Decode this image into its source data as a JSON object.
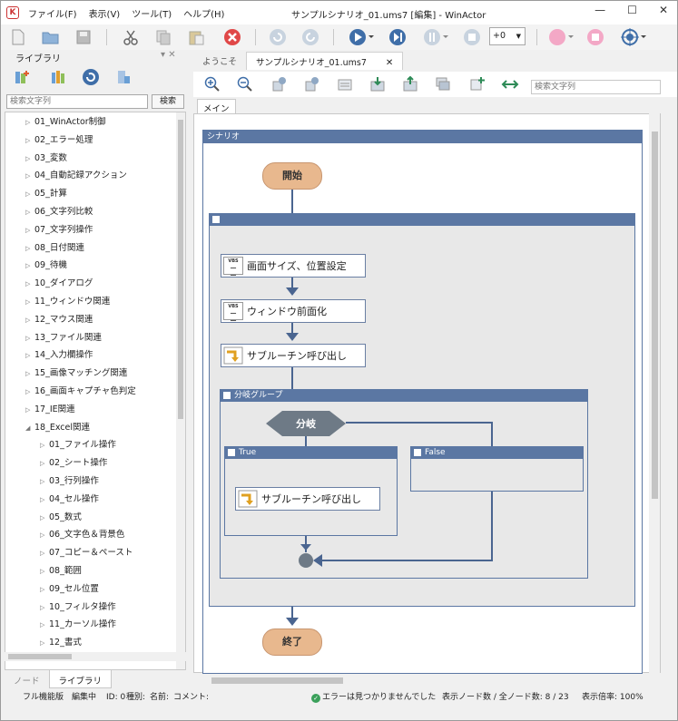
{
  "window": {
    "title": "サンプルシナリオ_01.ums7 [編集] - WinActor",
    "minimize": "—",
    "maximize": "☐",
    "close": "✕"
  },
  "menu": [
    "ファイル(F)",
    "表示(V)",
    "ツール(T)",
    "ヘルプ(H)"
  ],
  "toolbar": {
    "speed_value": "+0"
  },
  "library": {
    "title": "ライブラリ",
    "pin": "▾ ✕",
    "search_placeholder": "検索文字列",
    "search_button": "検索",
    "items": [
      {
        "label": "01_WinActor制御",
        "indent": 0,
        "expanded": false
      },
      {
        "label": "02_エラー処理",
        "indent": 0,
        "expanded": false
      },
      {
        "label": "03_変数",
        "indent": 0,
        "expanded": false
      },
      {
        "label": "04_自動記録アクション",
        "indent": 0,
        "expanded": false
      },
      {
        "label": "05_計算",
        "indent": 0,
        "expanded": false
      },
      {
        "label": "06_文字列比較",
        "indent": 0,
        "expanded": false
      },
      {
        "label": "07_文字列操作",
        "indent": 0,
        "expanded": false
      },
      {
        "label": "08_日付関連",
        "indent": 0,
        "expanded": false
      },
      {
        "label": "09_待機",
        "indent": 0,
        "expanded": false
      },
      {
        "label": "10_ダイアログ",
        "indent": 0,
        "expanded": false
      },
      {
        "label": "11_ウィンドウ関連",
        "indent": 0,
        "expanded": false
      },
      {
        "label": "12_マウス関連",
        "indent": 0,
        "expanded": false
      },
      {
        "label": "13_ファイル関連",
        "indent": 0,
        "expanded": false
      },
      {
        "label": "14_入力欄操作",
        "indent": 0,
        "expanded": false
      },
      {
        "label": "15_画像マッチング関連",
        "indent": 0,
        "expanded": false
      },
      {
        "label": "16_画面キャプチャ色判定",
        "indent": 0,
        "expanded": false
      },
      {
        "label": "17_IE関連",
        "indent": 0,
        "expanded": false
      },
      {
        "label": "18_Excel関連",
        "indent": 0,
        "expanded": true
      },
      {
        "label": "01_ファイル操作",
        "indent": 1,
        "expanded": false
      },
      {
        "label": "02_シート操作",
        "indent": 1,
        "expanded": false
      },
      {
        "label": "03_行列操作",
        "indent": 1,
        "expanded": false
      },
      {
        "label": "04_セル操作",
        "indent": 1,
        "expanded": false
      },
      {
        "label": "05_数式",
        "indent": 1,
        "expanded": false
      },
      {
        "label": "06_文字色＆背景色",
        "indent": 1,
        "expanded": false
      },
      {
        "label": "07_コピー＆ペースト",
        "indent": 1,
        "expanded": false
      },
      {
        "label": "08_範囲",
        "indent": 1,
        "expanded": false
      },
      {
        "label": "09_セル位置",
        "indent": 1,
        "expanded": false
      },
      {
        "label": "10_フィルタ操作",
        "indent": 1,
        "expanded": false
      },
      {
        "label": "11_カーソル操作",
        "indent": 1,
        "expanded": false
      },
      {
        "label": "12_書式",
        "indent": 1,
        "expanded": false
      }
    ],
    "bottom_tabs": [
      "ノード",
      "ライブラリ"
    ]
  },
  "editor": {
    "tabs": [
      {
        "label": "ようこそ",
        "active": false
      },
      {
        "label": "サンプルシナリオ_01.ums7",
        "active": true
      }
    ],
    "tab_close": "✕",
    "search_placeholder": "検索文字列",
    "main_tab": "メイン"
  },
  "flow": {
    "scenario_label": "シナリオ",
    "start": "開始",
    "end": "終了",
    "group_collapse": "-",
    "nodes": {
      "screen_size": "画面サイズ、位置設定",
      "window_front": "ウィンドウ前面化",
      "subroutine1": "サブルーチン呼び出し",
      "subroutine2": "サブルーチン呼び出し"
    },
    "branch_group": "分岐グループ",
    "branch": "分岐",
    "true_label": "True",
    "false_label": "False"
  },
  "status": {
    "mode": "フル機能版",
    "state": "編集中",
    "id": "ID: 0",
    "kind": "種別:",
    "name": "名前:",
    "comment": "コメント:",
    "error": "エラーは見つかりませんでした",
    "node_count": "表示ノード数 / 全ノード数: 8 / 23",
    "zoom": "表示倍率: 100%"
  },
  "colors": {
    "group_blue": "#5b77a3",
    "terminal": "#e8b88e",
    "branch": "#6e7a86"
  }
}
